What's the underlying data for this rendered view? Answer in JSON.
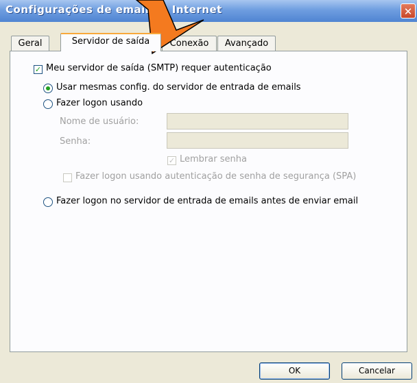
{
  "window": {
    "title": "Configurações de email da Internet",
    "close_glyph": "✕"
  },
  "tabs": [
    {
      "label": "Geral"
    },
    {
      "label": "Servidor de saída",
      "active": true
    },
    {
      "label": "Conexão"
    },
    {
      "label": "Avançado"
    }
  ],
  "smtp": {
    "requires_auth_label": "Meu servidor de saída (SMTP) requer autenticação",
    "requires_auth_checked": true,
    "same_settings_label": "Usar mesmas config. do servidor de entrada de emails",
    "same_settings_selected": true,
    "logon_using_label": "Fazer logon usando",
    "username_label": "Nome de usuário:",
    "username_value": "",
    "password_label": "Senha:",
    "password_value": "",
    "remember_password_label": "Lembrar senha",
    "remember_password_checked": true,
    "spa_label": "Fazer logon usando autenticação de senha de segurança (SPA)",
    "spa_checked": false,
    "logon_before_send_label": "Fazer logon no servidor de entrada de emails antes de enviar email"
  },
  "buttons": {
    "ok": "OK",
    "cancel": "Cancelar"
  },
  "icons": {
    "checkmark": "✓"
  },
  "colors": {
    "annotation_arrow": "#f47a1f",
    "check_green": "#21a121",
    "title_gradient_bottom": "#4f84d2"
  }
}
